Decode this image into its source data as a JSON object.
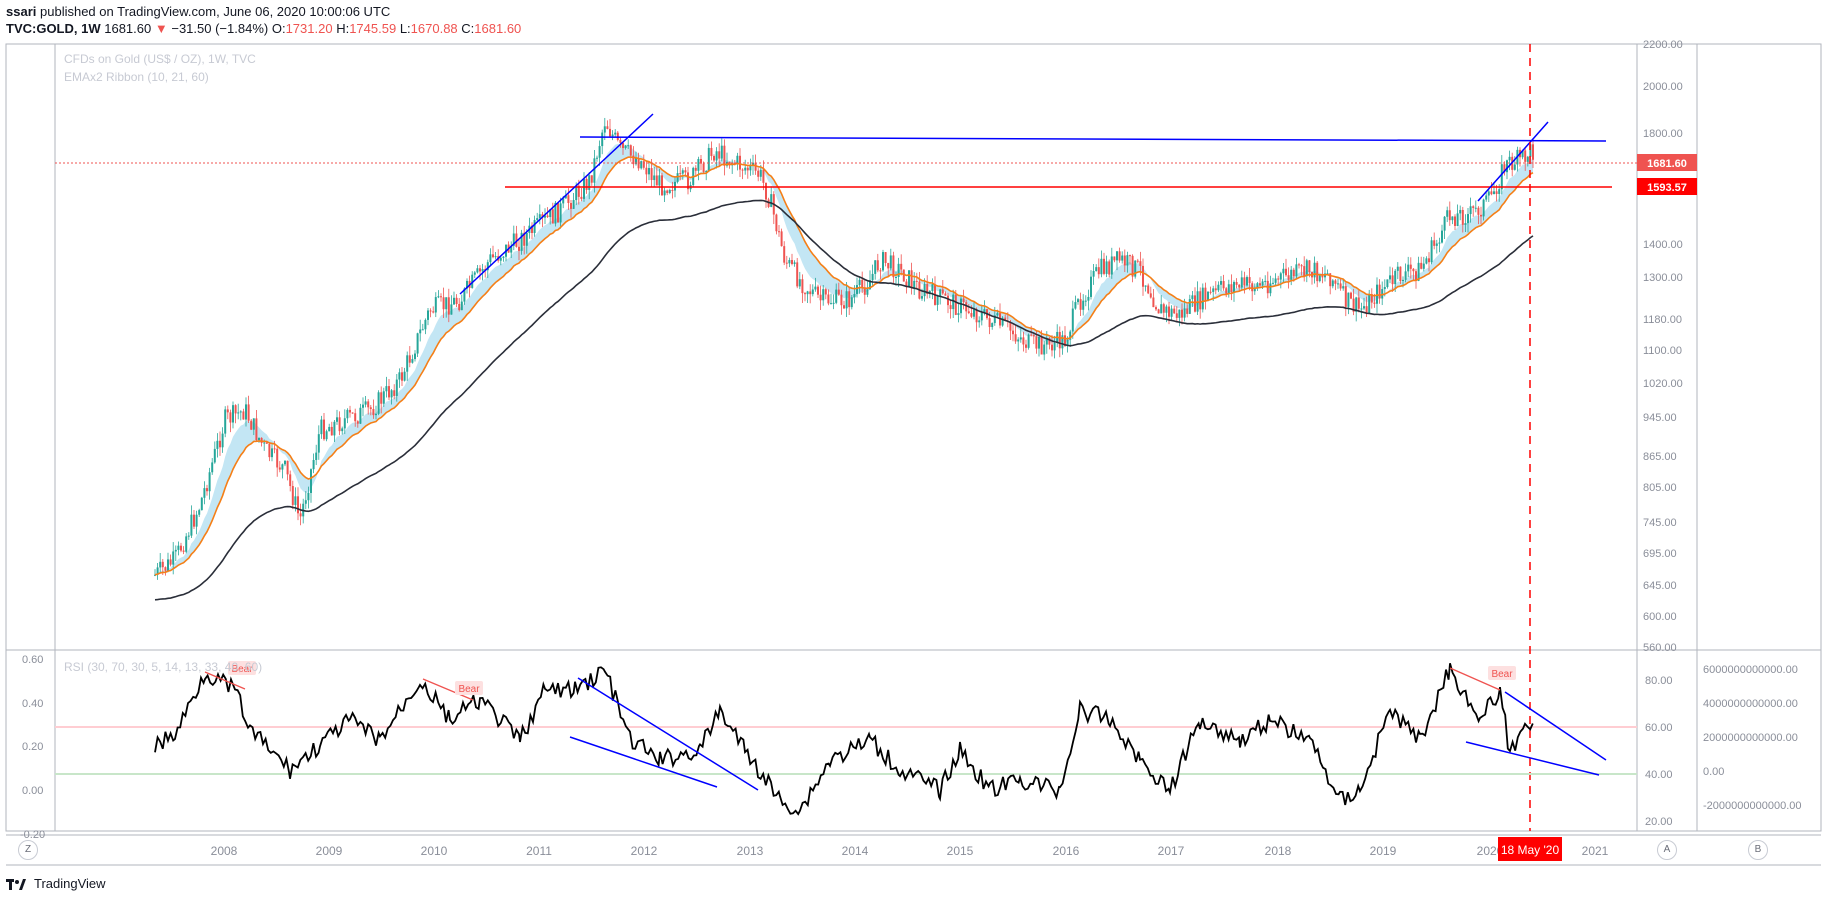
{
  "header": {
    "user": "ssari",
    "published": "published on TradingView.com, June 06, 2020 10:00:06 UTC",
    "symbol": "TVC:GOLD, 1W",
    "last": "1681.60",
    "change": "−31.50 (−1.84%)",
    "o_label": "O:",
    "o_val": "1731.20",
    "h_label": "H:",
    "h_val": "1745.59",
    "l_label": "L:",
    "l_val": "1670.88",
    "c_label": "C:",
    "c_val": "1681.60"
  },
  "legend": {
    "main_title": "CFDs on Gold (US$ / OZ), 1W, TVC",
    "indicator": "EMAx2 Ribbon (10, 21, 60)",
    "rsi": "RSI (30, 70, 30, 5, 14, 13, 33, 40, 60)"
  },
  "price_axis": {
    "ticks": [
      "2200.00",
      "2000.00",
      "1800.00",
      "1400.00",
      "1300.00",
      "1180.00",
      "1100.00",
      "1020.00",
      "945.00",
      "865.00",
      "805.00",
      "745.00",
      "695.00",
      "645.00",
      "600.00",
      "560.00"
    ],
    "price_label": "1681.60",
    "level_label": "1593.57"
  },
  "rsi_left_axis": {
    "ticks": [
      "0.60",
      "0.40",
      "0.20",
      "0.00",
      "-0.20"
    ]
  },
  "rsi_right_axis": {
    "ticks": [
      "80.00",
      "60.00",
      "40.00",
      "20.00"
    ]
  },
  "rsi_far_axis": {
    "ticks": [
      "6000000000000.00",
      "4000000000000.00",
      "2000000000000.00",
      "0.00",
      "-2000000000000.00"
    ]
  },
  "time_axis": {
    "years": [
      "2008",
      "2009",
      "2010",
      "2011",
      "2012",
      "2013",
      "2014",
      "2015",
      "2016",
      "2017",
      "2018",
      "2019",
      "2020",
      "2021"
    ],
    "cursor_label": "18 May '20"
  },
  "bear_labels": [
    "Bear",
    "Bear",
    "Bear"
  ],
  "buttons": {
    "z": "Z",
    "a": "A",
    "b": "B"
  },
  "footer": {
    "brand": "TradingView"
  },
  "colors": {
    "up": "#26a69a",
    "down": "#ef5350",
    "ema_fast": "#f57f17",
    "ema_slow": "#2a2e39",
    "ribbon": "#a9dbf0",
    "trend": "#0000ff",
    "level": "#ff0000"
  }
}
